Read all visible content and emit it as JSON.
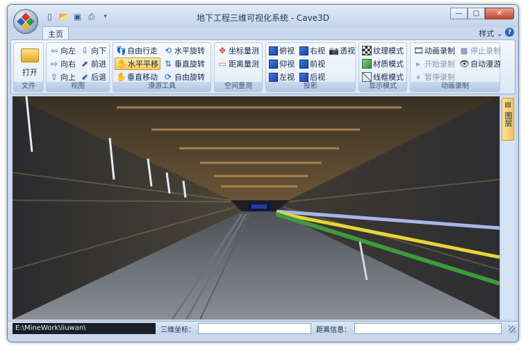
{
  "window": {
    "title": "地下工程三维可视化系统 - Cave3D"
  },
  "controls": {
    "minimize": "—",
    "maximize": "□",
    "close": "✕"
  },
  "tabs": {
    "home": "主页"
  },
  "style_menu": "样式 ⌄",
  "help": "?",
  "ribbon": {
    "file": {
      "title": "文件",
      "open": "打开"
    },
    "view": {
      "title": "视图",
      "left": "向左",
      "down": "向下",
      "right": "向右",
      "forward": "前进",
      "up": "向上",
      "back": "后退"
    },
    "roam": {
      "title": "漫游工具",
      "free_walk": "自由行走",
      "horiz_rotate": "水平旋转",
      "horiz_pan": "水平平移",
      "vert_rotate": "垂直旋转",
      "vert_move": "垂直移动",
      "free_rotate": "自由旋转"
    },
    "measure": {
      "title": "空间量测",
      "coord": "坐标量测",
      "distance": "距离量测"
    },
    "projection": {
      "title": "投影",
      "top": "俯视",
      "right": "右视",
      "perspective": "透视",
      "bottom": "仰视",
      "front": "前视",
      "left": "左视",
      "rear": "后视"
    },
    "display": {
      "title": "显示模式",
      "texture": "纹理模式",
      "material": "材质模式",
      "wireframe": "线框模式"
    },
    "animation": {
      "title": "动画录制",
      "record": "动画录制",
      "stop": "停止录制",
      "start": "开始录制",
      "auto_roam": "自动漫游",
      "pause": "暂停录制"
    }
  },
  "sidepanel": {
    "tab": "图层"
  },
  "status": {
    "path": "E:\\MineWork\\liuwan\\",
    "coord_label": "三维坐标：",
    "distance_label": "距离信息："
  }
}
